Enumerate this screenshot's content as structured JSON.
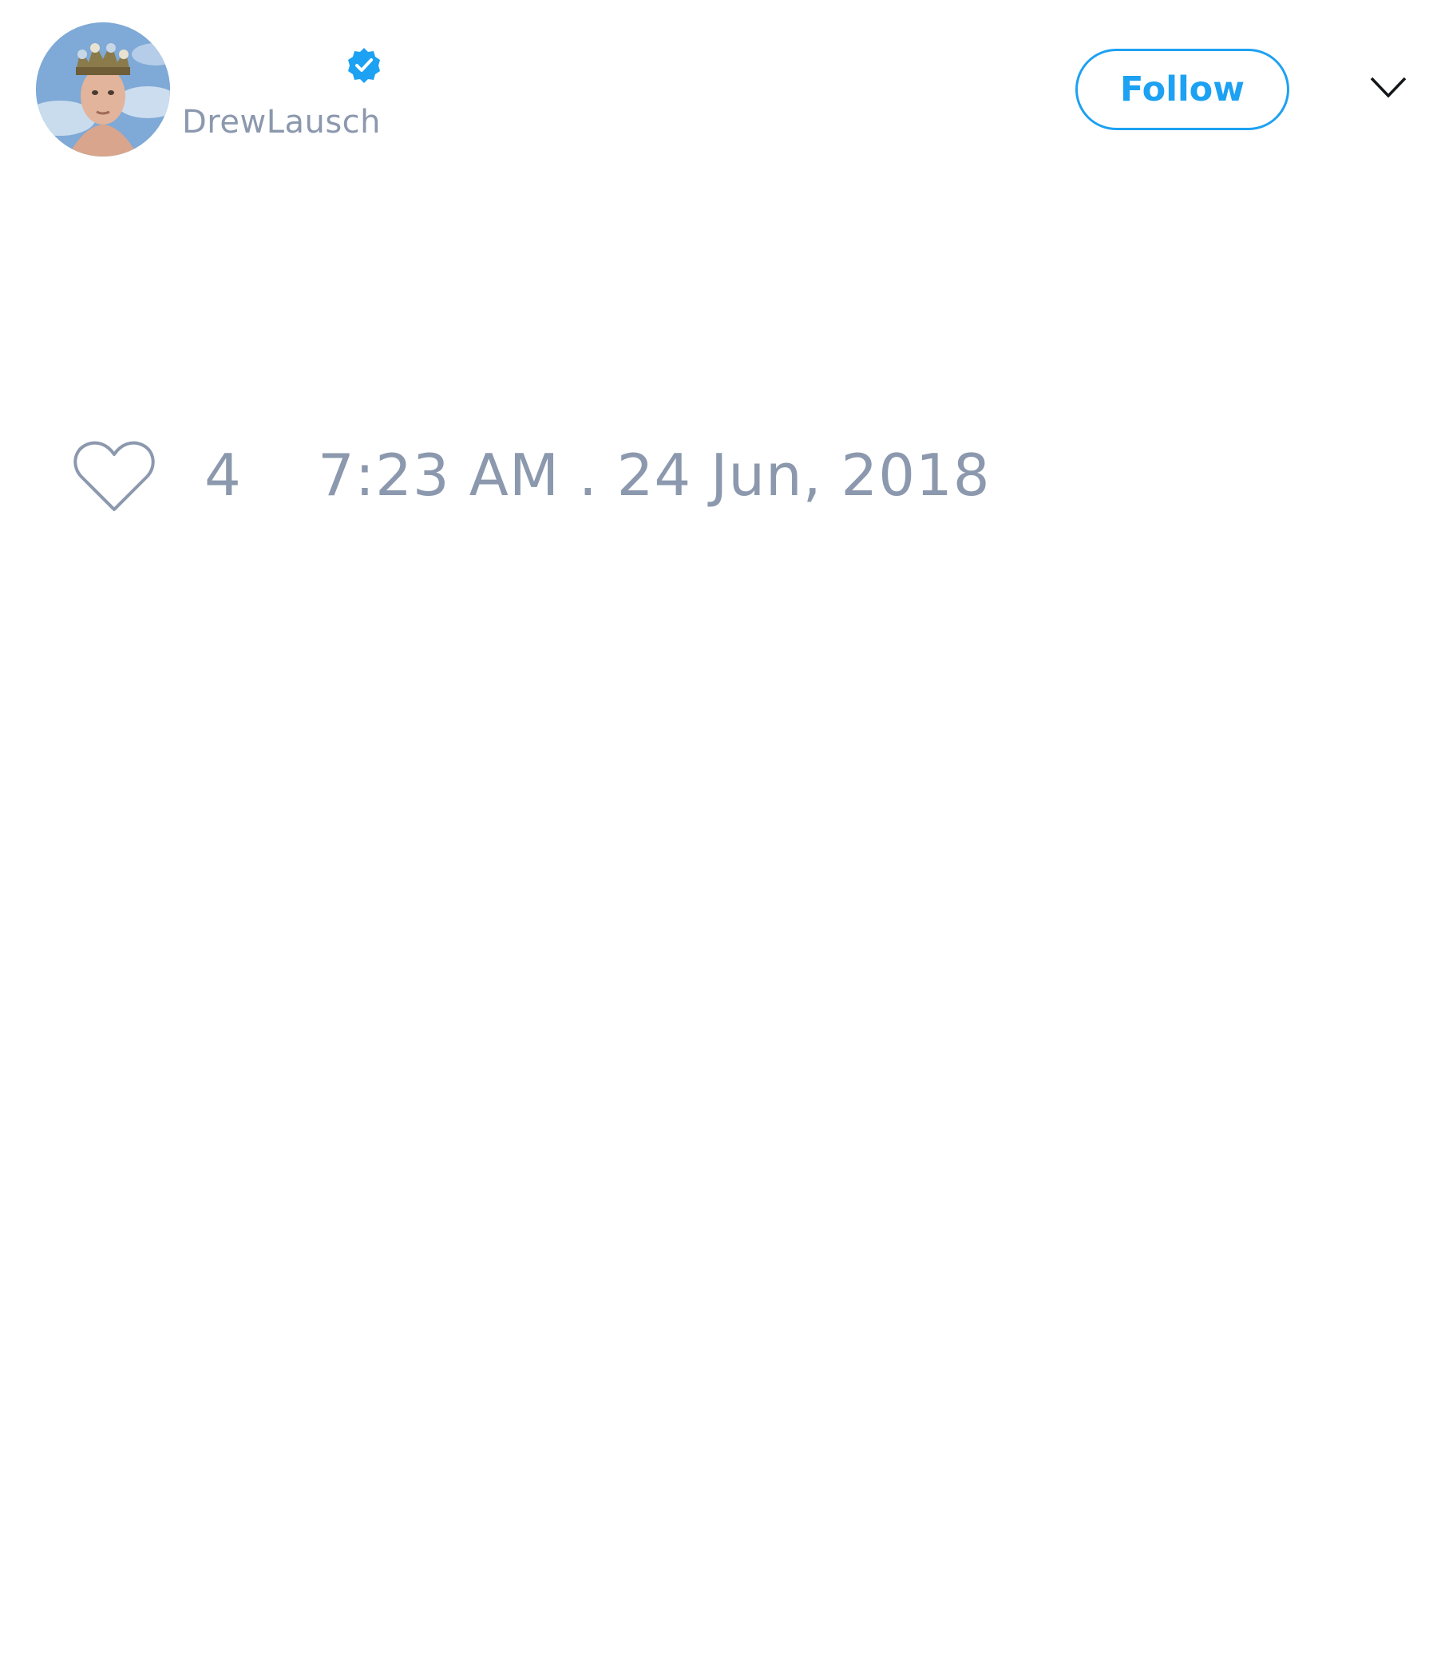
{
  "tweet": {
    "author": {
      "handle": "DrewLausch",
      "verified": true,
      "avatar_icon": "profile-photo"
    },
    "follow_label": "Follow",
    "menu_icon": "chevron-down-icon",
    "likes": {
      "icon": "heart-icon",
      "count": "4"
    },
    "timestamp": "7:23 AM . 24 Jun, 2018"
  },
  "colors": {
    "accent": "#1da1f2",
    "muted_text": "#8b98ad",
    "background": "#ffffff"
  }
}
